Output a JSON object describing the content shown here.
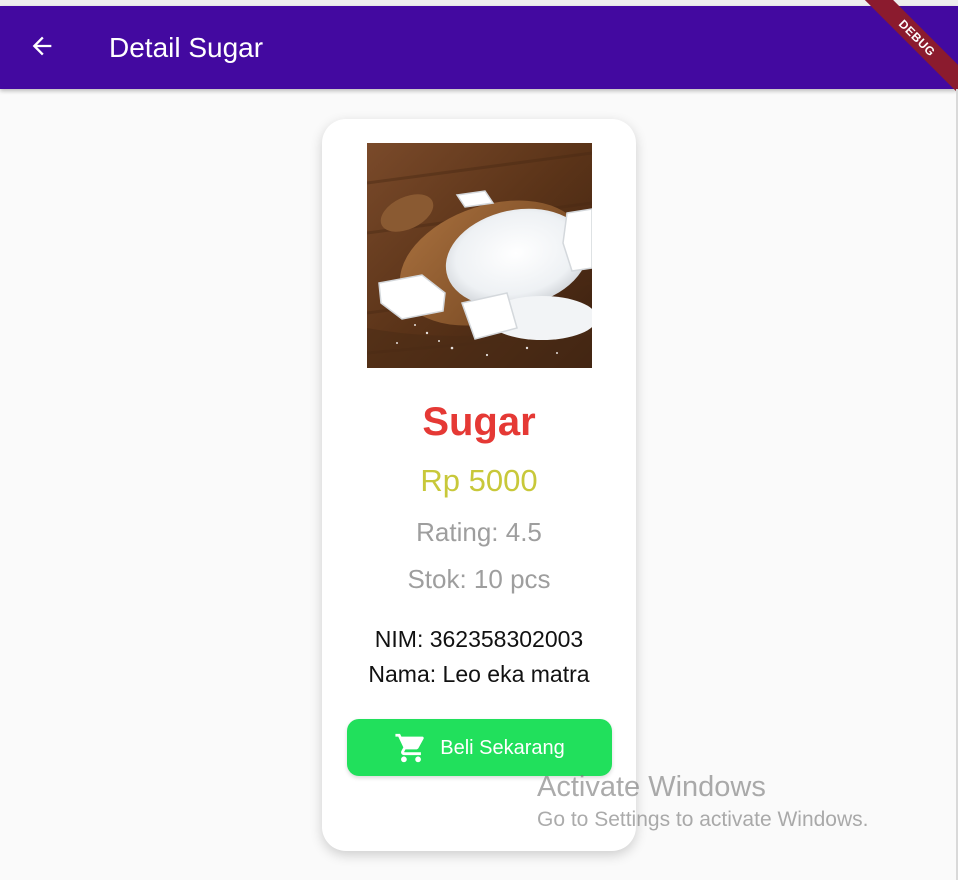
{
  "app_bar": {
    "title": "Detail Sugar",
    "background_color": "#4309a0",
    "back_icon": "arrow-back-icon",
    "debug_banner": "DEBUG"
  },
  "product": {
    "image_alt": "sugar-photo",
    "name": "Sugar",
    "name_color": "#e53935",
    "price": "Rp 5000",
    "price_color": "#c8c83a",
    "rating": "Rating: 4.5",
    "stock": "Stok: 10 pcs"
  },
  "student": {
    "nim": "NIM: 362358302003",
    "name": "Nama: Leo eka matra"
  },
  "buy_button": {
    "label": "Beli Sekarang",
    "icon": "shopping-cart-icon",
    "color": "#21e05c"
  },
  "watermark": {
    "title": "Activate Windows",
    "subtitle": "Go to Settings to activate Windows."
  }
}
